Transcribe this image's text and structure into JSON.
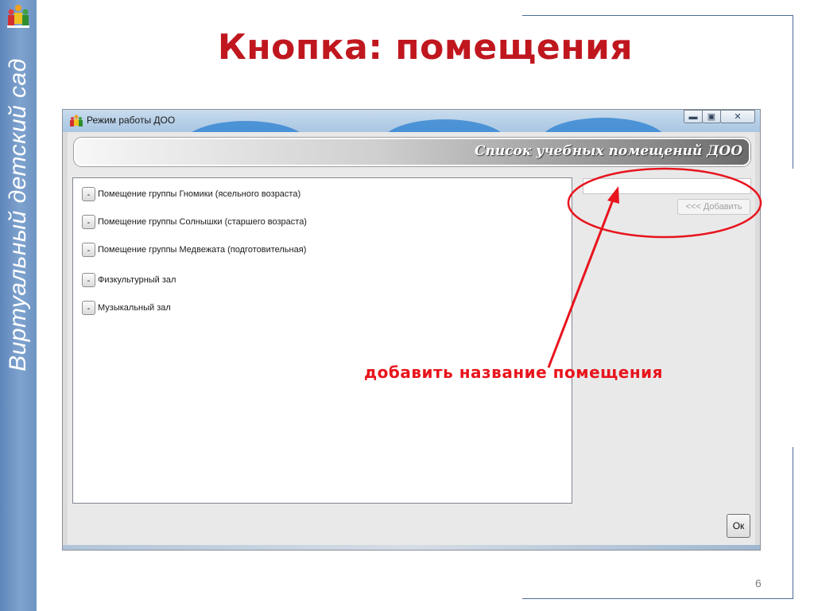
{
  "sidebar": {
    "brand_text": "Виртуальный детский сад",
    "logo_icon": "children-logo-icon"
  },
  "slide": {
    "title": "Кнопка: помещения",
    "page_number": "6"
  },
  "window": {
    "title": "Режим работы ДОО",
    "app_icon": "children-app-icon",
    "controls": {
      "minimize_icon": "minimize-icon",
      "maximize_icon": "maximize-icon",
      "close_icon": "close-icon"
    },
    "banner_title": "Список учебных помещений ДОО",
    "rooms": [
      {
        "remove_label": "-",
        "name": "Помещение группы Гномики (ясельного возраста)"
      },
      {
        "remove_label": "-",
        "name": "Помещение группы Солнышки (старшего возраста)"
      },
      {
        "remove_label": "-",
        "name": "Помещение группы Медвежата (подготовительная)"
      },
      {
        "remove_label": "-",
        "name": "Физкультурный зал"
      },
      {
        "remove_label": "-",
        "name": "Музыкальный зал"
      }
    ],
    "name_input": {
      "value": "",
      "placeholder": ""
    },
    "add_button_label": "<<< Добавить",
    "ok_button_label": "Ок"
  },
  "annotation": {
    "text": "добавить название помещения",
    "color": "#e8141d"
  },
  "colors": {
    "title_red": "#c0171f",
    "sidebar_blue": "#6d93c3",
    "frame_line": "#4b6d96"
  }
}
